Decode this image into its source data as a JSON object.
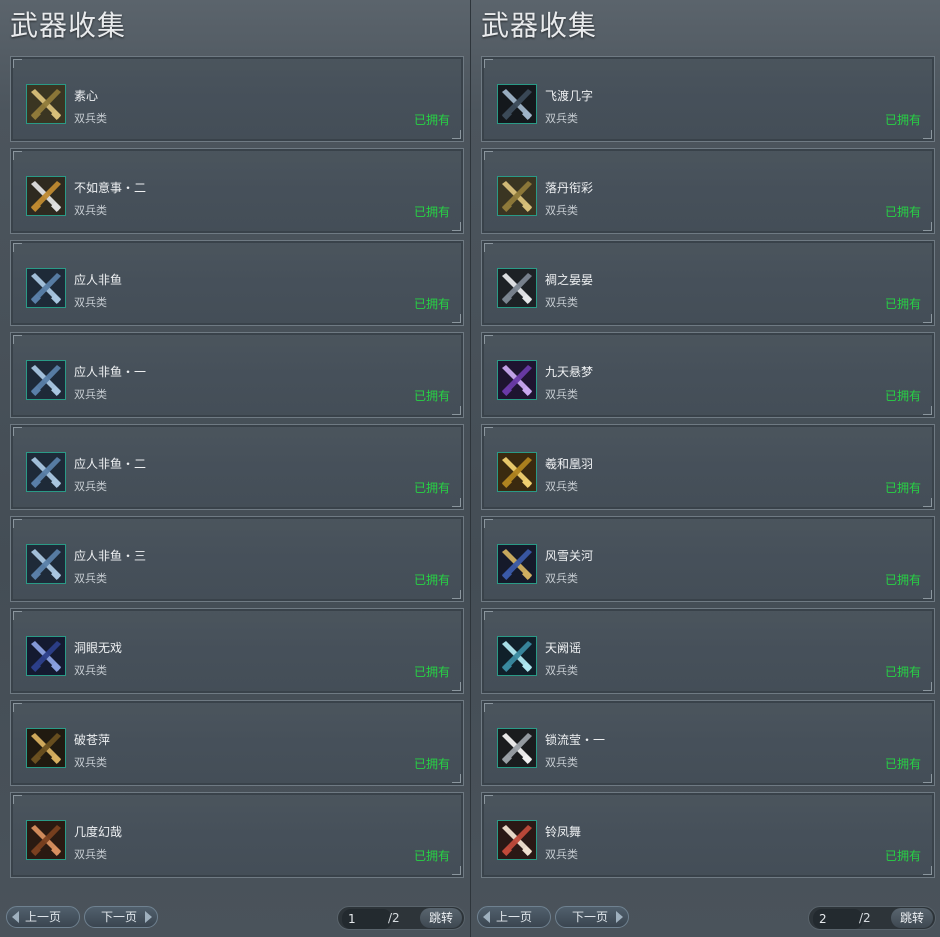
{
  "colors": {
    "owned": "#27d244",
    "icon_border": "#2a9a86"
  },
  "panels": [
    {
      "title": "武器收集",
      "items": [
        {
          "name": "素心",
          "category": "双兵类",
          "status": "已拥有",
          "icon": "crossed-gold-blades-icon"
        },
        {
          "name": "不如意事・二",
          "category": "双兵类",
          "status": "已拥有",
          "icon": "crossed-silver-gold-blades-icon"
        },
        {
          "name": "应人非鱼",
          "category": "双兵类",
          "status": "已拥有",
          "icon": "crossed-blue-cleavers-icon"
        },
        {
          "name": "应人非鱼・一",
          "category": "双兵类",
          "status": "已拥有",
          "icon": "crossed-blue-cleavers-icon"
        },
        {
          "name": "应人非鱼・二",
          "category": "双兵类",
          "status": "已拥有",
          "icon": "crossed-blue-cleavers-icon"
        },
        {
          "name": "应人非鱼・三",
          "category": "双兵类",
          "status": "已拥有",
          "icon": "crossed-blue-cleavers-icon"
        },
        {
          "name": "洞眼无戏",
          "category": "双兵类",
          "status": "已拥有",
          "icon": "crossed-navy-blades-icon"
        },
        {
          "name": "破苍萍",
          "category": "双兵类",
          "status": "已拥有",
          "icon": "crossed-bronze-blades-icon"
        },
        {
          "name": "几度幻哉",
          "category": "双兵类",
          "status": "已拥有",
          "icon": "crossed-copper-blades-icon"
        }
      ],
      "pager": {
        "prev": "上一页",
        "next": "下一页",
        "page": "1",
        "total": "/2",
        "jump": "跳转"
      }
    },
    {
      "title": "武器收集",
      "items": [
        {
          "name": "飞渡几字",
          "category": "双兵类",
          "status": "已拥有",
          "icon": "crossed-dark-blades-icon"
        },
        {
          "name": "落丹衔彩",
          "category": "双兵类",
          "status": "已拥有",
          "icon": "crossed-gold-blades-icon"
        },
        {
          "name": "裯之晏晏",
          "category": "双兵类",
          "status": "已拥有",
          "icon": "crossed-silver-blades-icon"
        },
        {
          "name": "九天悬梦",
          "category": "双兵类",
          "status": "已拥有",
          "icon": "crossed-purple-blades-icon"
        },
        {
          "name": "羲和凰羽",
          "category": "双兵类",
          "status": "已拥有",
          "icon": "crossed-golden-feather-blades-icon"
        },
        {
          "name": "风雪关河",
          "category": "双兵类",
          "status": "已拥有",
          "icon": "crossed-blue-gold-blades-icon"
        },
        {
          "name": "天阙谣",
          "category": "双兵类",
          "status": "已拥有",
          "icon": "crossed-cyan-blades-icon"
        },
        {
          "name": "锁流莹・一",
          "category": "双兵类",
          "status": "已拥有",
          "icon": "crossed-white-blades-icon"
        },
        {
          "name": "铃凤舞",
          "category": "双兵类",
          "status": "已拥有",
          "icon": "crossed-red-white-blades-icon"
        }
      ],
      "pager": {
        "prev": "上一页",
        "next": "下一页",
        "page": "2",
        "total": "/2",
        "jump": "跳转"
      }
    }
  ]
}
